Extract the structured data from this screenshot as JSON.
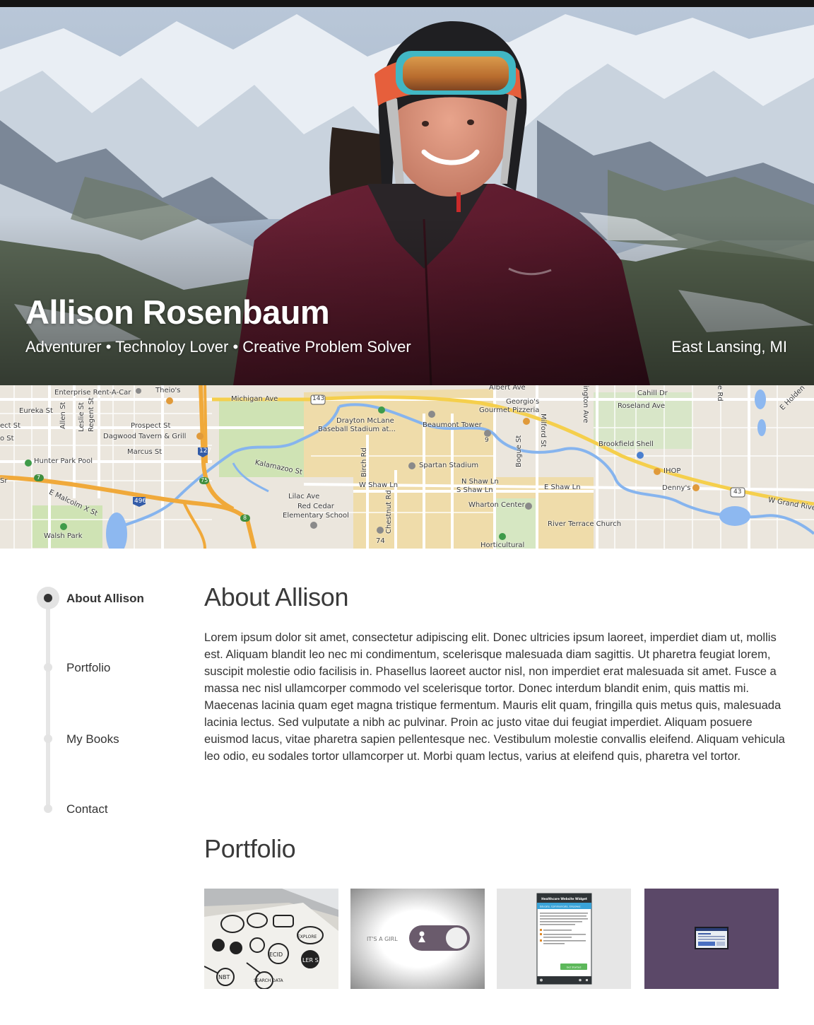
{
  "hero": {
    "name": "Allison Rosenbaum",
    "tagline": "Adventurer • Technoloy Lover • Creative Problem Solver",
    "location": "East Lansing, MI"
  },
  "map": {
    "labels": {
      "enterprise": "Enterprise Rent-A-Car",
      "theios": "Theio's",
      "michigan_ave": "Michigan Ave",
      "hwy_143": "143",
      "albert_ave": "Albert Ave",
      "georgios": "Georgio's",
      "gourmet_pizzeria": "Gourmet Pizzeria",
      "milford": "Milford St",
      "cahill": "Cahill Dr",
      "roseland": "Roseland Ave",
      "e_holden": "E Holden",
      "eureka": "Eureka St",
      "allen": "Allen St",
      "regent": "Regent St",
      "leslie": "Leslie St",
      "ect_st": "ect St",
      "prospect": "Prospect St",
      "dagwood": "Dagwood Tavern & Grill",
      "o_st": "o St",
      "marcus": "Marcus St",
      "drayton": "Drayton McLane",
      "baseball": "Baseball Stadium at...",
      "beaumont": "Beaumont Tower",
      "brookfield": "Brookfield Shell",
      "hunter_park": "Hunter Park Pool",
      "kalamazoo": "Kalamazoo St",
      "hwy_127": "127",
      "birch": "Birch Rd",
      "spartan": "Spartan Stadium",
      "bogue": "Bogue St",
      "ihop": "IHOP",
      "dennys": "Denny's",
      "hwy_43": "43",
      "w_grand_river": "W Grand Rive",
      "sr": "Sr",
      "e_malcolm": "E Malcolm X St",
      "hwy_496": "496",
      "lilac": "Lilac Ave",
      "red_cedar": "Red Cedar",
      "elementary": "Elementary School",
      "w_shaw": "W Shaw Ln",
      "n_shaw": "N Shaw Ln",
      "s_shaw": "S Shaw Ln",
      "e_shaw": "E Shaw Ln",
      "chestnut": "Chestnut Rd",
      "wharton": "Wharton Center",
      "river_terrace": "River Terrace Church",
      "walsh_park": "Walsh Park",
      "hwy_74": "74",
      "horticultural": "Horticultural",
      "ington": "ington Ave",
      "e_rd": "e Rd",
      "n9": "9",
      "n7": "7",
      "n75": "75",
      "n8": "8"
    }
  },
  "nav": {
    "items": [
      {
        "label": "About Allison",
        "active": true
      },
      {
        "label": "Portfolio",
        "active": false
      },
      {
        "label": "My Books",
        "active": false
      },
      {
        "label": "Contact",
        "active": false
      }
    ]
  },
  "about": {
    "title": "About Allison",
    "body": "Lorem ipsum dolor sit amet, consectetur adipiscing elit. Donec ultricies ipsum laoreet, imperdiet diam ut, mollis est. Aliquam blandit leo nec mi condimentum, scelerisque malesuada diam sagittis. Ut pharetra feugiat lorem, suscipit molestie odio facilisis in. Phasellus laoreet auctor nisl, non imperdiet erat malesuada sit amet. Fusce a massa nec nisl ullamcorper commodo vel scelerisque tortor. Donec interdum blandit enim, quis mattis mi. Maecenas lacinia quam eget magna tristique fermentum. Mauris elit quam, fringilla quis metus quis, malesuada lacinia lectus. Sed vulputate a nibh ac pulvinar. Proin ac justo vitae dui feugiat imperdiet. Aliquam posuere euismod lacus, vitae pharetra sapien pellentesque nec. Vestibulum molestie convallis eleifend. Aliquam vehicula leo odio, eu sodales tortor ullamcorper ut. Morbi quam lectus, varius at eleifend quis, pharetra vel tortor."
  },
  "portfolio": {
    "title": "Portfolio",
    "items": [
      {
        "sketch_words": [
          "EXPLORE",
          "ECID",
          "LER S",
          "NBT",
          "SEARCH DATA"
        ]
      },
      {
        "toggle_label": "IT'S A GIRL"
      },
      {
        "widget_title": "Healthcare Website Widget",
        "widget_subtitle": "Educate. Communicate. Empower.",
        "widget_intro": "Use this tool to see if a change in treatment or a referral to more specialized medical care could help you reach your goals and ideally, control your condition without side-effects!",
        "widget_steps": [
          "Answer 6 questions",
          "Receive a report tailored to your medical history",
          "Choose the report with your care provider"
        ],
        "widget_button": "Get Started"
      },
      {
        "description": "browser window preview"
      }
    ]
  },
  "colors": {
    "accent_dark": "#333333",
    "nav_track": "#e6e6e6",
    "portfolio_purple": "#5b4868",
    "widget_blue": "#3aa3d8",
    "widget_green": "#5db85b"
  }
}
